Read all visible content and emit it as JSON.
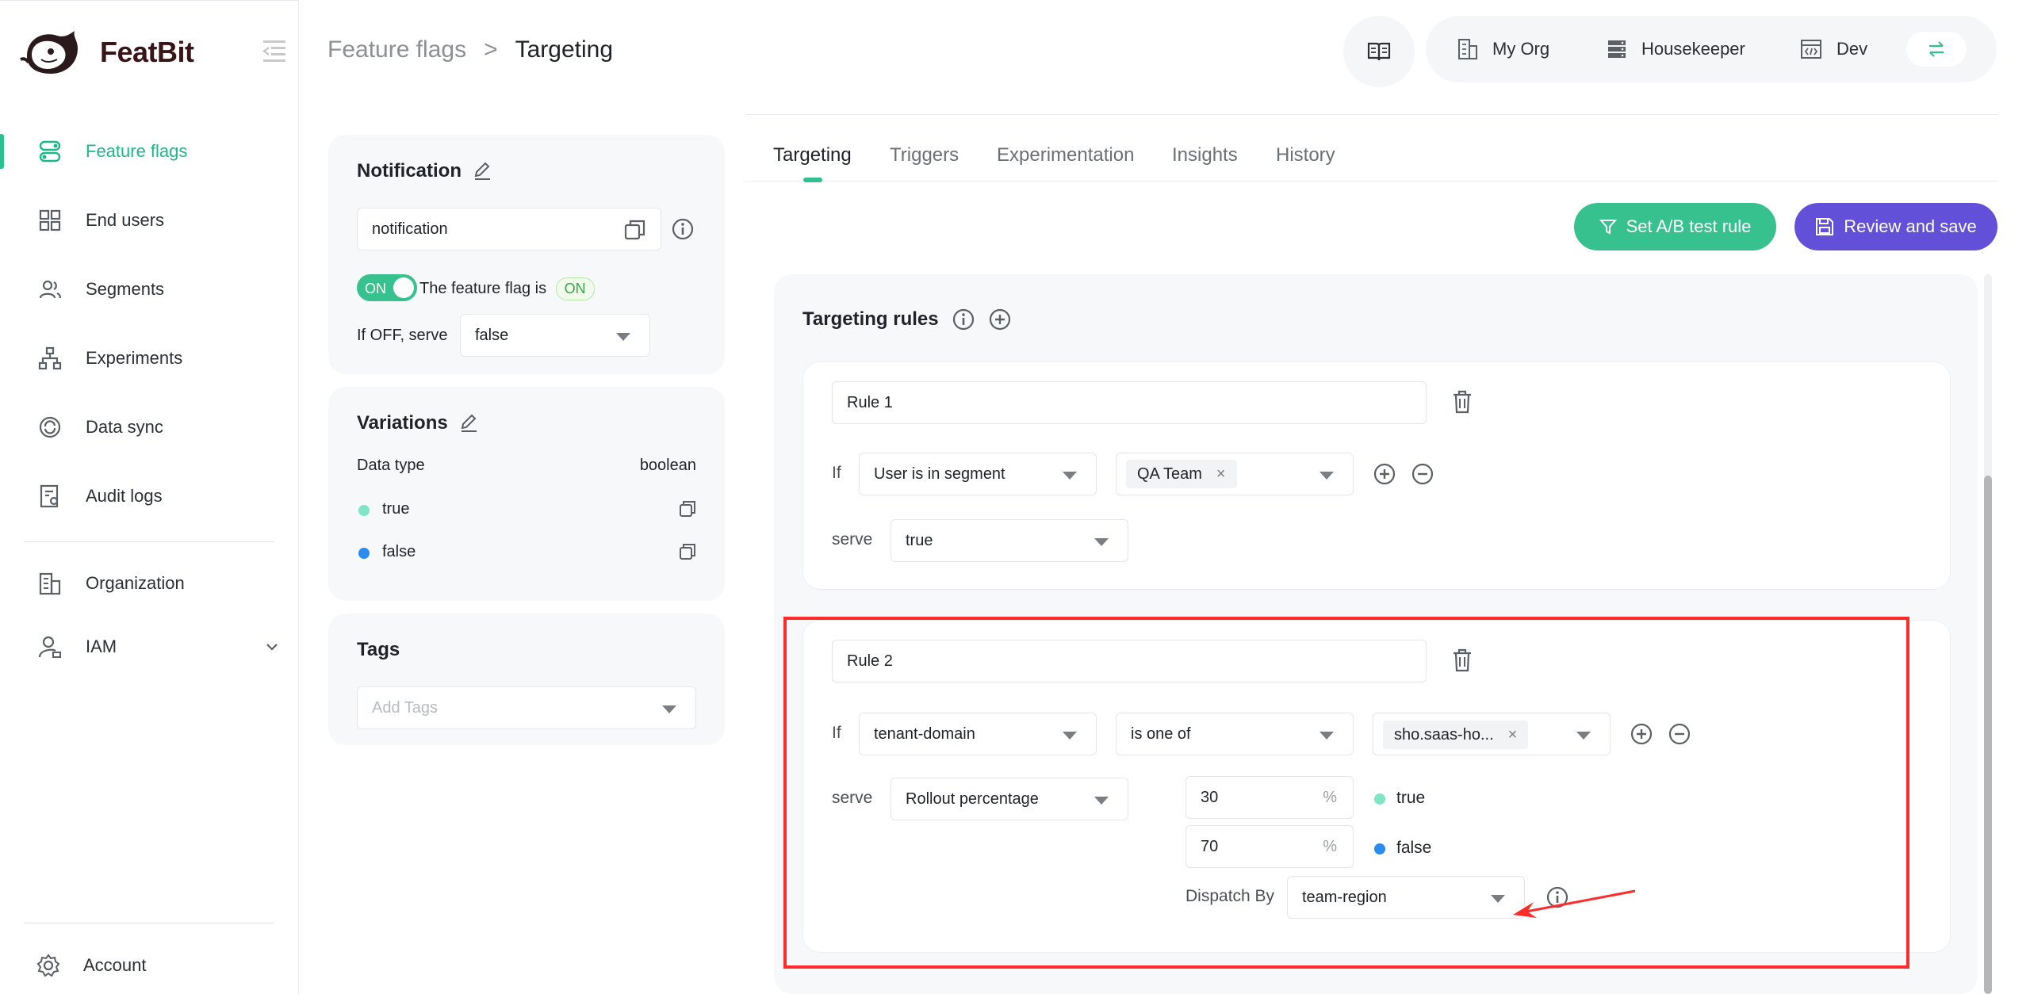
{
  "app": {
    "name": "FeatBit"
  },
  "nav": {
    "items": [
      {
        "label": "Feature flags",
        "icon": "toggle-icon",
        "active": true
      },
      {
        "label": "End users",
        "icon": "grid-icon"
      },
      {
        "label": "Segments",
        "icon": "users-icon"
      },
      {
        "label": "Experiments",
        "icon": "flow-icon"
      },
      {
        "label": "Data sync",
        "icon": "sync-icon"
      },
      {
        "label": "Audit logs",
        "icon": "audit-icon"
      },
      {
        "label": "Organization",
        "icon": "building-icon"
      },
      {
        "label": "IAM",
        "icon": "user-lock-icon"
      }
    ],
    "account": "Account"
  },
  "header": {
    "breadcrumb_root": "Feature flags",
    "breadcrumb_sep": ">",
    "breadcrumb_current": "Targeting",
    "org": "My Org",
    "project": "Housekeeper",
    "env": "Dev"
  },
  "flag": {
    "title": "Notification",
    "key": "notification",
    "toggle_label": "ON",
    "status_text": "The feature flag is",
    "status_badge": "ON",
    "off_serve_label": "If OFF, serve",
    "off_serve_value": "false"
  },
  "variations": {
    "title": "Variations",
    "data_type_label": "Data type",
    "data_type_value": "boolean",
    "items": [
      {
        "label": "true",
        "color": "#7fe6c5"
      },
      {
        "label": "false",
        "color": "#2a8cf0"
      }
    ]
  },
  "tags": {
    "title": "Tags",
    "placeholder": "Add Tags"
  },
  "tabs": [
    "Targeting",
    "Triggers",
    "Experimentation",
    "Insights",
    "History"
  ],
  "actions": {
    "ab_test": "Set A/B test rule",
    "review": "Review and save",
    "ab_color": "#36c18f",
    "review_color": "#6350d9"
  },
  "targeting": {
    "title": "Targeting rules",
    "rule1": {
      "name": "Rule 1",
      "if_label": "If",
      "condition": "User is in segment",
      "segment_tag": "QA Team",
      "serve_label": "serve",
      "serve_value": "true"
    },
    "rule2": {
      "name": "Rule 2",
      "if_label": "If",
      "attribute": "tenant-domain",
      "operator": "is one of",
      "value_tag": "sho.saas-ho...",
      "serve_label": "serve",
      "serve_value": "Rollout percentage",
      "pct_true": "30",
      "pct_false": "70",
      "pct_unit": "%",
      "true_label": "true",
      "false_label": "false",
      "dispatch_label": "Dispatch By",
      "dispatch_value": "team-region"
    }
  }
}
